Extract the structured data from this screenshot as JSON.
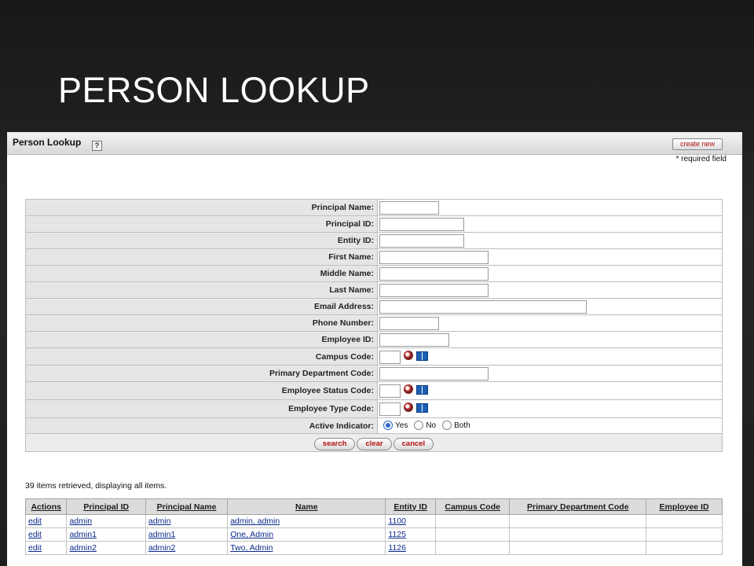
{
  "slide": {
    "title": "PERSON LOOKUP"
  },
  "page": {
    "title": "Person Lookup",
    "create_new": "create new",
    "required_note": "* required field"
  },
  "criteria": [
    {
      "label": "Principal Name:",
      "type": "text",
      "width": 76
    },
    {
      "label": "Principal ID:",
      "type": "text",
      "width": 108
    },
    {
      "label": "Entity ID:",
      "type": "text",
      "width": 108
    },
    {
      "label": "First Name:",
      "type": "text",
      "width": 139
    },
    {
      "label": "Middle Name:",
      "type": "text",
      "width": 139
    },
    {
      "label": "Last Name:",
      "type": "text",
      "width": 139
    },
    {
      "label": "Email Address:",
      "type": "text",
      "width": 264
    },
    {
      "label": "Phone Number:",
      "type": "text",
      "width": 76
    },
    {
      "label": "Employee ID:",
      "type": "text",
      "width": 89
    },
    {
      "label": "Campus Code:",
      "type": "lookup"
    },
    {
      "label": "Primary Department Code:",
      "type": "text",
      "width": 139
    },
    {
      "label": "Employee Status Code:",
      "type": "lookup"
    },
    {
      "label": "Employee Type Code:",
      "type": "lookup"
    },
    {
      "label": "Active Indicator:",
      "type": "radio"
    }
  ],
  "active_options": {
    "yes": "Yes",
    "no": "No",
    "both": "Both",
    "selected": "Yes"
  },
  "buttons": {
    "search": "search",
    "clear": "clear",
    "cancel": "cancel"
  },
  "results": {
    "count_text": "39 items retrieved, displaying all items.",
    "headers": [
      "Actions",
      "Principal ID",
      "Principal Name",
      "Name",
      "Entity ID",
      "Campus Code",
      "Primary Department Code",
      "Employee ID"
    ],
    "rows": [
      [
        "edit",
        "admin",
        "admin",
        "admin, admin",
        "1100",
        "",
        "",
        ""
      ],
      [
        "edit",
        "admin1",
        "admin1",
        "One, Admin",
        "1125",
        "",
        "",
        ""
      ],
      [
        "edit",
        "admin2",
        "admin2",
        "Two, Admin",
        "1126",
        "",
        "",
        ""
      ]
    ]
  }
}
